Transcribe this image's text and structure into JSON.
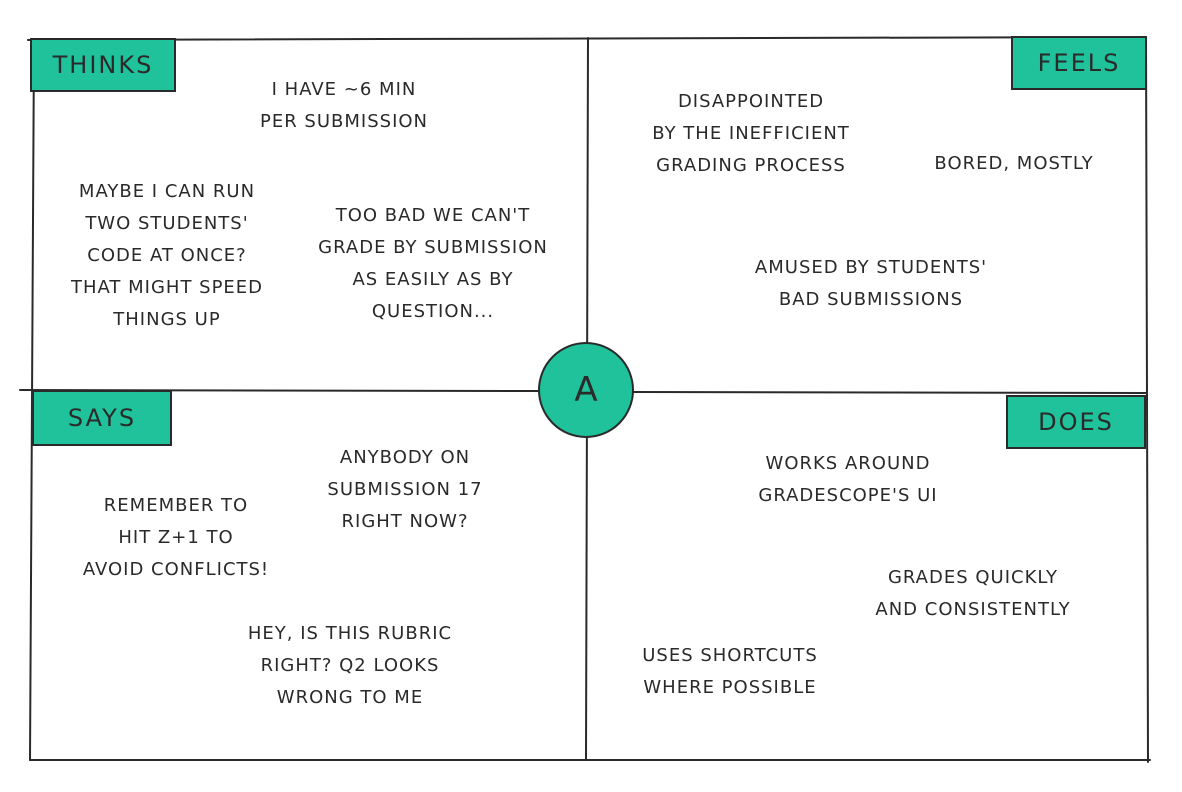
{
  "quadrants": {
    "thinks": {
      "label": "THINKS",
      "notes": [
        [
          "I HAVE ~6 MIN",
          "PER SUBMISSION"
        ],
        [
          "MAYBE I CAN RUN",
          "TWO STUDENTS'",
          "CODE AT ONCE?",
          "THAT MIGHT SPEED",
          "THINGS UP"
        ],
        [
          "TOO BAD WE CAN'T",
          "GRADE BY SUBMISSION",
          "AS EASILY AS BY",
          "QUESTION..."
        ]
      ]
    },
    "feels": {
      "label": "FEELS",
      "notes": [
        [
          "DISAPPOINTED",
          "BY THE INEFFICIENT",
          "GRADING PROCESS"
        ],
        [
          "BORED, MOSTLY"
        ],
        [
          "AMUSED BY STUDENTS'",
          "BAD SUBMISSIONS"
        ]
      ]
    },
    "says": {
      "label": "SAYS",
      "notes": [
        [
          "ANYBODY ON",
          "SUBMISSION 17",
          "RIGHT NOW?"
        ],
        [
          "REMEMBER TO",
          "HIT Z+1 TO",
          "AVOID CONFLICTS!"
        ],
        [
          "HEY, IS THIS RUBRIC",
          "RIGHT? Q2 LOOKS",
          "WRONG TO ME"
        ]
      ]
    },
    "does": {
      "label": "DOES",
      "notes": [
        [
          "WORKS AROUND",
          "GRADESCOPE'S UI"
        ],
        [
          "GRADES QUICKLY",
          "AND CONSISTENTLY"
        ],
        [
          "USES SHORTCUTS",
          "WHERE POSSIBLE"
        ]
      ]
    }
  },
  "center": {
    "label": "A"
  },
  "colors": {
    "accent": "#1fc29a",
    "ink": "#2a2a2a"
  }
}
